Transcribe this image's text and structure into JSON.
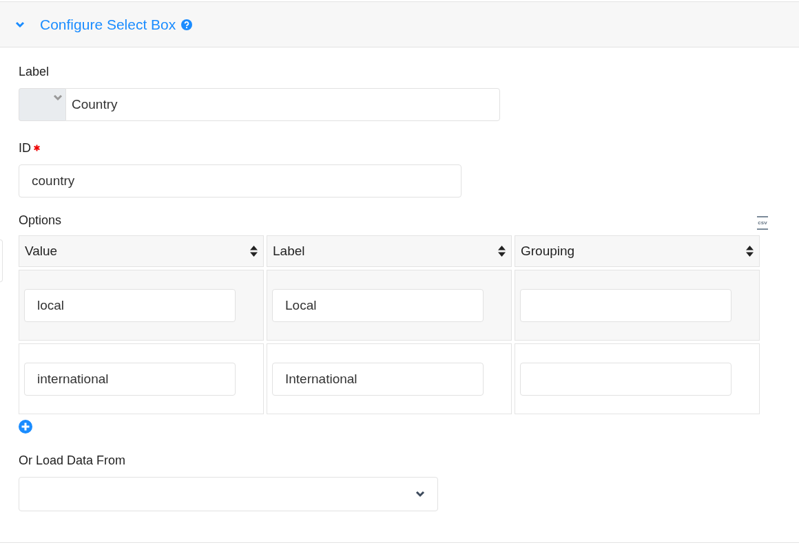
{
  "panel": {
    "title": "Configure Select Box",
    "expanded": true
  },
  "label_field": {
    "label": "Label",
    "value": "Country"
  },
  "id_field": {
    "label": "ID",
    "required": true,
    "value": "country"
  },
  "options": {
    "label": "Options",
    "csv_icon_text": "csv",
    "columns": [
      "Value",
      "Label",
      "Grouping"
    ],
    "rows": [
      {
        "cells": [
          "local",
          "Local",
          ""
        ]
      },
      {
        "cells": [
          "international",
          "International",
          ""
        ]
      }
    ]
  },
  "load_from": {
    "label": "Or Load Data From"
  }
}
